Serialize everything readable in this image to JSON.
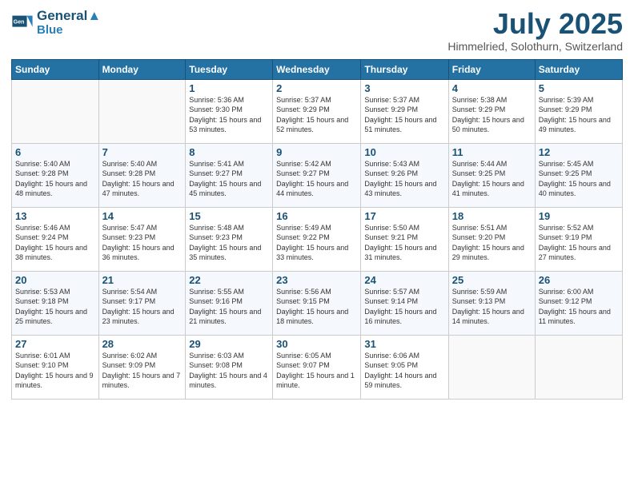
{
  "header": {
    "logo_line1": "General",
    "logo_line2": "Blue",
    "month_title": "July 2025",
    "location": "Himmelried, Solothurn, Switzerland"
  },
  "days_of_week": [
    "Sunday",
    "Monday",
    "Tuesday",
    "Wednesday",
    "Thursday",
    "Friday",
    "Saturday"
  ],
  "weeks": [
    [
      {
        "day": "",
        "sunrise": "",
        "sunset": "",
        "daylight": ""
      },
      {
        "day": "",
        "sunrise": "",
        "sunset": "",
        "daylight": ""
      },
      {
        "day": "1",
        "sunrise": "Sunrise: 5:36 AM",
        "sunset": "Sunset: 9:30 PM",
        "daylight": "Daylight: 15 hours and 53 minutes."
      },
      {
        "day": "2",
        "sunrise": "Sunrise: 5:37 AM",
        "sunset": "Sunset: 9:29 PM",
        "daylight": "Daylight: 15 hours and 52 minutes."
      },
      {
        "day": "3",
        "sunrise": "Sunrise: 5:37 AM",
        "sunset": "Sunset: 9:29 PM",
        "daylight": "Daylight: 15 hours and 51 minutes."
      },
      {
        "day": "4",
        "sunrise": "Sunrise: 5:38 AM",
        "sunset": "Sunset: 9:29 PM",
        "daylight": "Daylight: 15 hours and 50 minutes."
      },
      {
        "day": "5",
        "sunrise": "Sunrise: 5:39 AM",
        "sunset": "Sunset: 9:29 PM",
        "daylight": "Daylight: 15 hours and 49 minutes."
      }
    ],
    [
      {
        "day": "6",
        "sunrise": "Sunrise: 5:40 AM",
        "sunset": "Sunset: 9:28 PM",
        "daylight": "Daylight: 15 hours and 48 minutes."
      },
      {
        "day": "7",
        "sunrise": "Sunrise: 5:40 AM",
        "sunset": "Sunset: 9:28 PM",
        "daylight": "Daylight: 15 hours and 47 minutes."
      },
      {
        "day": "8",
        "sunrise": "Sunrise: 5:41 AM",
        "sunset": "Sunset: 9:27 PM",
        "daylight": "Daylight: 15 hours and 45 minutes."
      },
      {
        "day": "9",
        "sunrise": "Sunrise: 5:42 AM",
        "sunset": "Sunset: 9:27 PM",
        "daylight": "Daylight: 15 hours and 44 minutes."
      },
      {
        "day": "10",
        "sunrise": "Sunrise: 5:43 AM",
        "sunset": "Sunset: 9:26 PM",
        "daylight": "Daylight: 15 hours and 43 minutes."
      },
      {
        "day": "11",
        "sunrise": "Sunrise: 5:44 AM",
        "sunset": "Sunset: 9:25 PM",
        "daylight": "Daylight: 15 hours and 41 minutes."
      },
      {
        "day": "12",
        "sunrise": "Sunrise: 5:45 AM",
        "sunset": "Sunset: 9:25 PM",
        "daylight": "Daylight: 15 hours and 40 minutes."
      }
    ],
    [
      {
        "day": "13",
        "sunrise": "Sunrise: 5:46 AM",
        "sunset": "Sunset: 9:24 PM",
        "daylight": "Daylight: 15 hours and 38 minutes."
      },
      {
        "day": "14",
        "sunrise": "Sunrise: 5:47 AM",
        "sunset": "Sunset: 9:23 PM",
        "daylight": "Daylight: 15 hours and 36 minutes."
      },
      {
        "day": "15",
        "sunrise": "Sunrise: 5:48 AM",
        "sunset": "Sunset: 9:23 PM",
        "daylight": "Daylight: 15 hours and 35 minutes."
      },
      {
        "day": "16",
        "sunrise": "Sunrise: 5:49 AM",
        "sunset": "Sunset: 9:22 PM",
        "daylight": "Daylight: 15 hours and 33 minutes."
      },
      {
        "day": "17",
        "sunrise": "Sunrise: 5:50 AM",
        "sunset": "Sunset: 9:21 PM",
        "daylight": "Daylight: 15 hours and 31 minutes."
      },
      {
        "day": "18",
        "sunrise": "Sunrise: 5:51 AM",
        "sunset": "Sunset: 9:20 PM",
        "daylight": "Daylight: 15 hours and 29 minutes."
      },
      {
        "day": "19",
        "sunrise": "Sunrise: 5:52 AM",
        "sunset": "Sunset: 9:19 PM",
        "daylight": "Daylight: 15 hours and 27 minutes."
      }
    ],
    [
      {
        "day": "20",
        "sunrise": "Sunrise: 5:53 AM",
        "sunset": "Sunset: 9:18 PM",
        "daylight": "Daylight: 15 hours and 25 minutes."
      },
      {
        "day": "21",
        "sunrise": "Sunrise: 5:54 AM",
        "sunset": "Sunset: 9:17 PM",
        "daylight": "Daylight: 15 hours and 23 minutes."
      },
      {
        "day": "22",
        "sunrise": "Sunrise: 5:55 AM",
        "sunset": "Sunset: 9:16 PM",
        "daylight": "Daylight: 15 hours and 21 minutes."
      },
      {
        "day": "23",
        "sunrise": "Sunrise: 5:56 AM",
        "sunset": "Sunset: 9:15 PM",
        "daylight": "Daylight: 15 hours and 18 minutes."
      },
      {
        "day": "24",
        "sunrise": "Sunrise: 5:57 AM",
        "sunset": "Sunset: 9:14 PM",
        "daylight": "Daylight: 15 hours and 16 minutes."
      },
      {
        "day": "25",
        "sunrise": "Sunrise: 5:59 AM",
        "sunset": "Sunset: 9:13 PM",
        "daylight": "Daylight: 15 hours and 14 minutes."
      },
      {
        "day": "26",
        "sunrise": "Sunrise: 6:00 AM",
        "sunset": "Sunset: 9:12 PM",
        "daylight": "Daylight: 15 hours and 11 minutes."
      }
    ],
    [
      {
        "day": "27",
        "sunrise": "Sunrise: 6:01 AM",
        "sunset": "Sunset: 9:10 PM",
        "daylight": "Daylight: 15 hours and 9 minutes."
      },
      {
        "day": "28",
        "sunrise": "Sunrise: 6:02 AM",
        "sunset": "Sunset: 9:09 PM",
        "daylight": "Daylight: 15 hours and 7 minutes."
      },
      {
        "day": "29",
        "sunrise": "Sunrise: 6:03 AM",
        "sunset": "Sunset: 9:08 PM",
        "daylight": "Daylight: 15 hours and 4 minutes."
      },
      {
        "day": "30",
        "sunrise": "Sunrise: 6:05 AM",
        "sunset": "Sunset: 9:07 PM",
        "daylight": "Daylight: 15 hours and 1 minute."
      },
      {
        "day": "31",
        "sunrise": "Sunrise: 6:06 AM",
        "sunset": "Sunset: 9:05 PM",
        "daylight": "Daylight: 14 hours and 59 minutes."
      },
      {
        "day": "",
        "sunrise": "",
        "sunset": "",
        "daylight": ""
      },
      {
        "day": "",
        "sunrise": "",
        "sunset": "",
        "daylight": ""
      }
    ]
  ]
}
